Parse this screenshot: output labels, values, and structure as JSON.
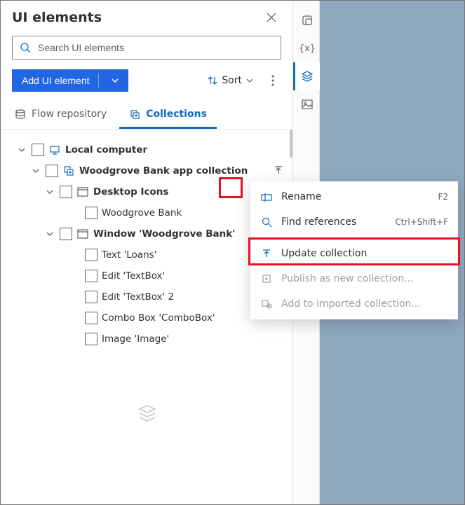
{
  "panel": {
    "title": "UI elements",
    "search_placeholder": "Search UI elements",
    "add_button": "Add UI element",
    "sort_label": "Sort"
  },
  "tabs": [
    {
      "label": "Flow repository",
      "active": false
    },
    {
      "label": "Collections",
      "active": true
    }
  ],
  "tree": {
    "root": {
      "label": "Local computer",
      "children": [
        {
          "label": "Woodgrove Bank app collection",
          "children": [
            {
              "label": "Desktop Icons",
              "children": [
                {
                  "label": "Woodgrove Bank"
                }
              ]
            },
            {
              "label": "Window 'Woodgrove Bank'",
              "children": [
                {
                  "label": "Text 'Loans'"
                },
                {
                  "label": "Edit 'TextBox'"
                },
                {
                  "label": "Edit 'TextBox' 2"
                },
                {
                  "label": "Combo Box 'ComboBox'"
                },
                {
                  "label": "Image 'Image'"
                }
              ]
            }
          ]
        }
      ]
    }
  },
  "context_menu": {
    "items": [
      {
        "label": "Rename",
        "shortcut": "F2",
        "icon": "rename",
        "enabled": true
      },
      {
        "label": "Find references",
        "shortcut": "Ctrl+Shift+F",
        "icon": "search",
        "enabled": true
      },
      {
        "sep": true
      },
      {
        "label": "Update collection",
        "icon": "upload",
        "enabled": true,
        "highlighted": true
      },
      {
        "label": "Publish as new collection...",
        "icon": "publish",
        "enabled": false
      },
      {
        "label": "Add to imported collection...",
        "icon": "add-collection",
        "enabled": false
      }
    ]
  },
  "side_icons": [
    "flow-icon",
    "variables-icon",
    "layers-icon",
    "images-icon"
  ]
}
